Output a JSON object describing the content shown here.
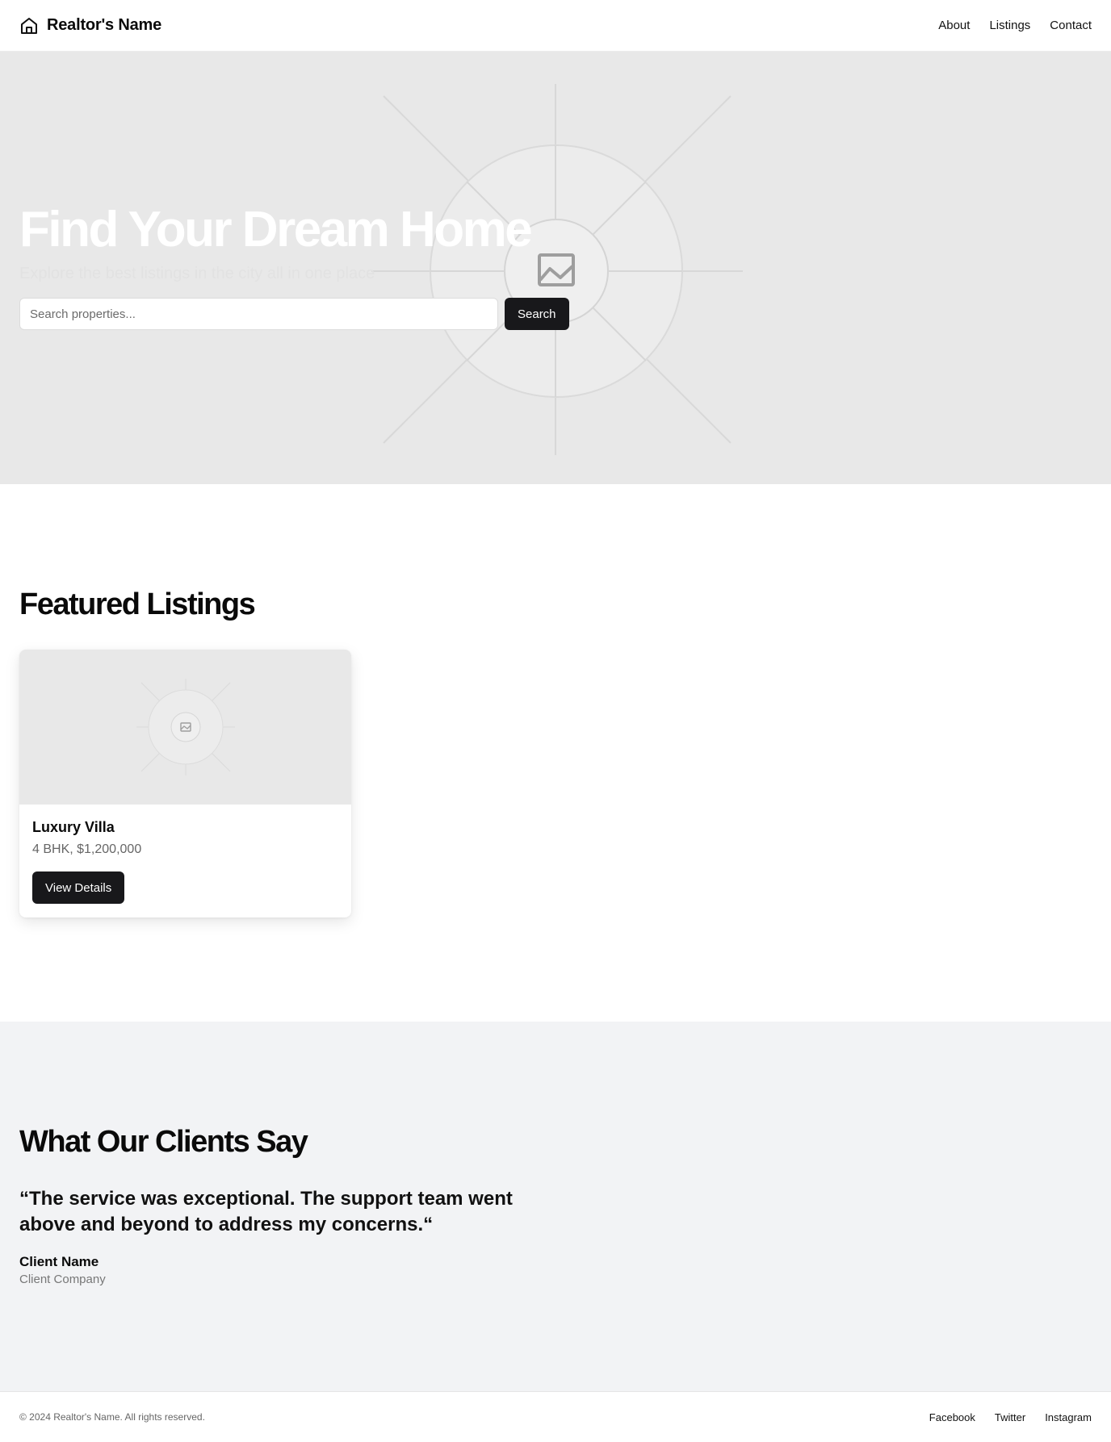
{
  "header": {
    "brand_name": "Realtor's Name",
    "brand_icon": "home-icon",
    "nav": [
      "About",
      "Listings",
      "Contact"
    ]
  },
  "hero": {
    "title": "Find Your Dream Home",
    "subtitle": "Explore the best listings in the city all in one place",
    "search_placeholder": "Search properties...",
    "search_button": "Search",
    "image_icon": "image-placeholder-icon"
  },
  "featured": {
    "title": "Featured Listings",
    "listings": [
      {
        "title": "Luxury Villa",
        "meta": "4 BHK, $1,200,000",
        "button": "View Details"
      }
    ]
  },
  "testimonials": {
    "title": "What Our Clients Say",
    "quote": "“The service was exceptional. The support team went above and beyond to address my concerns.“",
    "client_name": "Client Name",
    "client_company": "Client Company"
  },
  "footer": {
    "copyright": "© 2024 Realtor's Name. All rights reserved.",
    "links": [
      "Facebook",
      "Twitter",
      "Instagram"
    ]
  },
  "colors": {
    "primary_button": "#18181b",
    "hero_background": "#e8e8e8",
    "testimonials_background": "#f2f3f5"
  }
}
